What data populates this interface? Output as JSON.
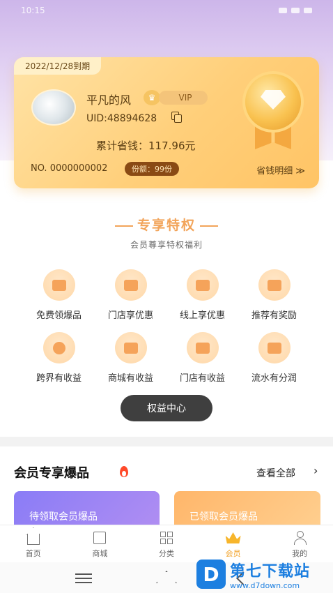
{
  "status_bar": {
    "time": "10:15"
  },
  "member_card": {
    "expire_text": "2022/12/28到期",
    "username": "平凡的风",
    "vip_badge": "VIP",
    "uid": "UID:48894628",
    "saved_text": "累计省钱：117.96元",
    "card_no": "NO. 0000000002",
    "quota_text": "份额：99份",
    "detail_link": "省钱明细 ≫",
    "accent_color": "#ffcf7a"
  },
  "privilege": {
    "title": "专享特权",
    "subtitle": "会员尊享特权福利",
    "items": [
      {
        "label": "免费领爆品",
        "icon": "gift-box-icon"
      },
      {
        "label": "门店享优惠",
        "icon": "ticket-icon"
      },
      {
        "label": "线上享优惠",
        "icon": "tag-icon"
      },
      {
        "label": "推荐有奖励",
        "icon": "reward-gift-icon"
      },
      {
        "label": "跨界有收益",
        "icon": "coin-icon"
      },
      {
        "label": "商城有收益",
        "icon": "wallet-icon"
      },
      {
        "label": "门店有收益",
        "icon": "store-card-icon"
      },
      {
        "label": "流水有分润",
        "icon": "document-icon"
      }
    ],
    "center_button": "权益中心"
  },
  "products": {
    "title": "会员专享爆品",
    "see_all": "查看全部",
    "arrow": "›",
    "promo_left": "待领取会员爆品",
    "promo_right": "已领取会员爆品"
  },
  "tabbar": {
    "items": [
      {
        "label": "首页",
        "icon": "home-icon"
      },
      {
        "label": "商城",
        "icon": "shop-bag-icon"
      },
      {
        "label": "分类",
        "icon": "category-grid-icon"
      },
      {
        "label": "会员",
        "icon": "crown-icon",
        "active": true
      },
      {
        "label": "我的",
        "icon": "user-icon"
      }
    ],
    "active_color": "#f2a32a"
  },
  "watermark": {
    "logo": "D",
    "title": "第七下载站",
    "url": "www.d7down.com"
  }
}
